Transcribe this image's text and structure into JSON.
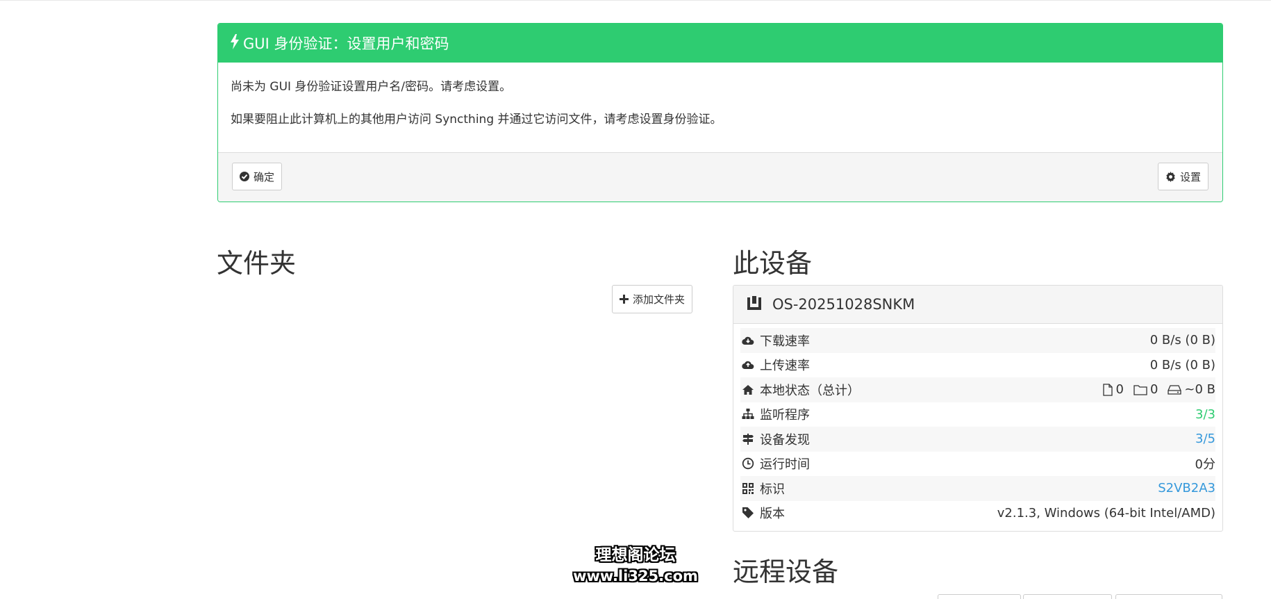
{
  "alert": {
    "title": "GUI 身份验证：设置用户和密码",
    "line1": "尚未为 GUI 身份验证设置用户名/密码。请考虑设置。",
    "line2": "如果要阻止此计算机上的其他用户访问 Syncthing 并通过它访问文件，请考虑设置身份验证。",
    "ok_label": "确定",
    "settings_label": "设置"
  },
  "folders": {
    "title": "文件夹",
    "add_label": "添加文件夹"
  },
  "this_device": {
    "title": "此设备",
    "name": "OS-20251028SNKM",
    "rows": {
      "download": {
        "label": "下载速率",
        "value": "0 B/s (0 B)"
      },
      "upload": {
        "label": "上传速率",
        "value": "0 B/s (0 B)"
      },
      "local_state": {
        "label": "本地状态（总计）",
        "files": "0",
        "dirs": "0",
        "size": "~0 B"
      },
      "listeners": {
        "label": "监听程序",
        "value": "3/3"
      },
      "discovery": {
        "label": "设备发现",
        "value": "3/5"
      },
      "uptime": {
        "label": "运行时间",
        "value": "0分"
      },
      "identity": {
        "label": "标识",
        "value": "S2VB2A3"
      },
      "version": {
        "label": "版本",
        "value": "v2.1.3, Windows (64-bit Intel/AMD)"
      }
    }
  },
  "remote_devices": {
    "title": "远程设备"
  },
  "watermark": {
    "line1": "理想阁论坛",
    "line2": "www.li325.com"
  },
  "colors": {
    "accent_green": "#2ecc71",
    "link_blue": "#3498db"
  },
  "icons": [
    "bolt-icon",
    "check-circle-icon",
    "gear-icon",
    "plus-icon",
    "desktop-icon",
    "cloud-download-icon",
    "cloud-upload-icon",
    "home-icon",
    "file-icon",
    "folder-icon",
    "hdd-icon",
    "sitemap-icon",
    "signpost-icon",
    "clock-icon",
    "qrcode-icon",
    "tag-icon"
  ]
}
